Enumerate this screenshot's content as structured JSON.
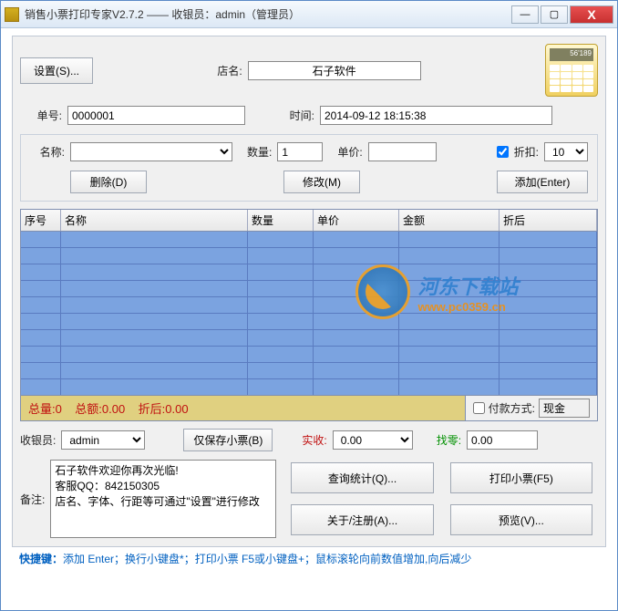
{
  "title": "销售小票打印专家V2.7.2 —— 收银员：admin（管理员）",
  "win": {
    "min": "—",
    "max": "▢",
    "close": "X"
  },
  "toolbar": {
    "settings": "设置(S)..."
  },
  "store": {
    "label": "店名:",
    "value": "石子软件"
  },
  "calc_disp": "56'189",
  "order": {
    "no_label": "单号:",
    "no": "0000001",
    "time_label": "时间:",
    "time": "2014-09-12 18:15:38"
  },
  "item": {
    "name_label": "名称:",
    "name": "",
    "qty_label": "数量:",
    "qty": "1",
    "price_label": "单价:",
    "price": "",
    "discount_chk": "折扣:",
    "discount_val": "10",
    "delete": "删除(D)",
    "edit": "修改(M)",
    "add": "添加(Enter)"
  },
  "cols": {
    "seq": "序号",
    "name": "名称",
    "qty": "数量",
    "price": "单价",
    "amount": "金额",
    "after": "折后"
  },
  "totals": {
    "qty": "总量:0",
    "amount": "总额:0.00",
    "after": "折后:0.00"
  },
  "payment": {
    "chk": "付款方式:",
    "value": "现金"
  },
  "cashier": {
    "label": "收银员:",
    "value": "admin"
  },
  "save_only": "仅保存小票(B)",
  "recv": {
    "label": "实收:",
    "value": "0.00"
  },
  "change": {
    "label": "找零:",
    "value": "0.00"
  },
  "remark": {
    "label": "备注:",
    "text": "石子软件欢迎你再次光临!\n客服QQ：842150305\n店名、字体、行距等可通过\"设置\"进行修改"
  },
  "buttons": {
    "stats": "查询统计(Q)...",
    "print": "打印小票(F5)",
    "about": "关于/注册(A)...",
    "preview": "预览(V)..."
  },
  "hint": {
    "pre": "快捷键：",
    "body": "添加 Enter；换行小键盘*；打印小票 F5或小键盘+；鼠标滚轮向前数值增加,向后减少"
  },
  "watermark": {
    "t1": "河东下载站",
    "t2": "www.pc0359.cn"
  }
}
